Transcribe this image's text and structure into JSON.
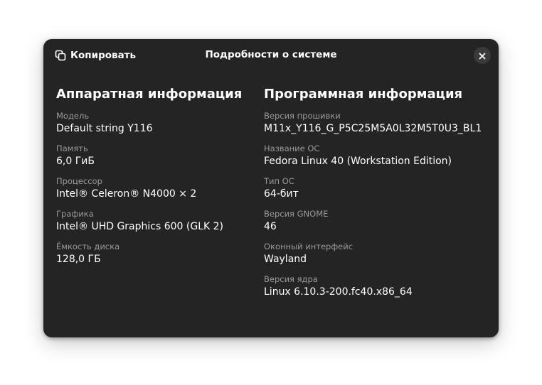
{
  "header": {
    "copy_label": "Копировать",
    "title": "Подробности о системе",
    "copy_icon": "copy-icon",
    "close_icon": "close-icon"
  },
  "hardware": {
    "heading": "Аппаратная информация",
    "rows": [
      {
        "label": "Модель",
        "value": "Default string Y116"
      },
      {
        "label": "Память",
        "value": "6,0 ГиБ"
      },
      {
        "label": "Процессор",
        "value": "Intel® Celeron® N4000 × 2"
      },
      {
        "label": "Графика",
        "value": "Intel® UHD Graphics 600 (GLK 2)"
      },
      {
        "label": "Ёмкость диска",
        "value": "128,0 ГБ"
      }
    ]
  },
  "software": {
    "heading": "Программная информация",
    "rows": [
      {
        "label": "Версия прошивки",
        "value": "M11x_Y116_G_P5C25M5A0L32M5T0U3_BL1"
      },
      {
        "label": "Название ОС",
        "value": "Fedora Linux 40 (Workstation Edition)"
      },
      {
        "label": "Тип ОС",
        "value": "64-бит"
      },
      {
        "label": "Версия GNOME",
        "value": "46"
      },
      {
        "label": "Оконный интерфейс",
        "value": "Wayland"
      },
      {
        "label": "Версия ядра",
        "value": "Linux 6.10.3-200.fc40.x86_64"
      }
    ]
  },
  "colors": {
    "dialog_bg": "#242424",
    "label": "#9a9a9a",
    "text": "#ffffff"
  }
}
